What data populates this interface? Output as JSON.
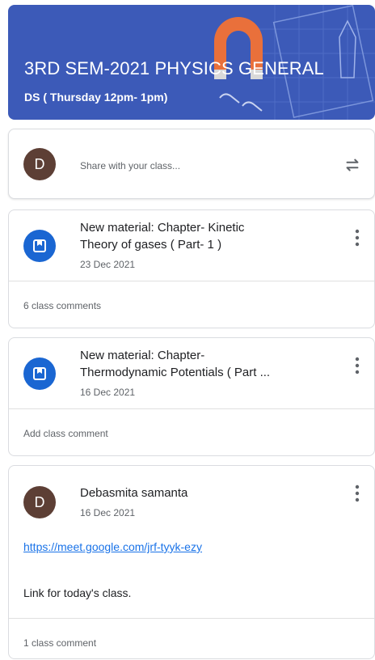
{
  "banner": {
    "title": "3RD SEM-2021 PHYSICS GENERAL",
    "subtitle": "DS ( Thursday 12pm- 1pm)",
    "color": "#3c5ab8"
  },
  "share": {
    "avatar_letter": "D",
    "placeholder": "Share with your class...",
    "repost_icon": "repost-icon"
  },
  "posts": [
    {
      "icon": "material-icon",
      "title_line1": "New material: Chapter- Kinetic",
      "title_line2": "Theory of gases ( Part- 1 )",
      "date": "23 Dec 2021",
      "comment": "6 class comments"
    },
    {
      "icon": "material-icon",
      "title_line1": "New material: Chapter-",
      "title_line2": "Thermodynamic Potentials ( Part ...",
      "date": "16 Dec 2021",
      "comment": "Add class comment"
    },
    {
      "avatar_letter": "D",
      "author": "Debasmita samanta",
      "date": "16 Dec 2021",
      "link": "https://meet.google.com/jrf-tyyk-ezy",
      "body": "Link for today's class.",
      "comment": "1 class comment"
    }
  ],
  "colors": {
    "accent_blue": "#1a66d2",
    "avatar_brown": "#5d3f35",
    "link_blue": "#1a73e8"
  }
}
